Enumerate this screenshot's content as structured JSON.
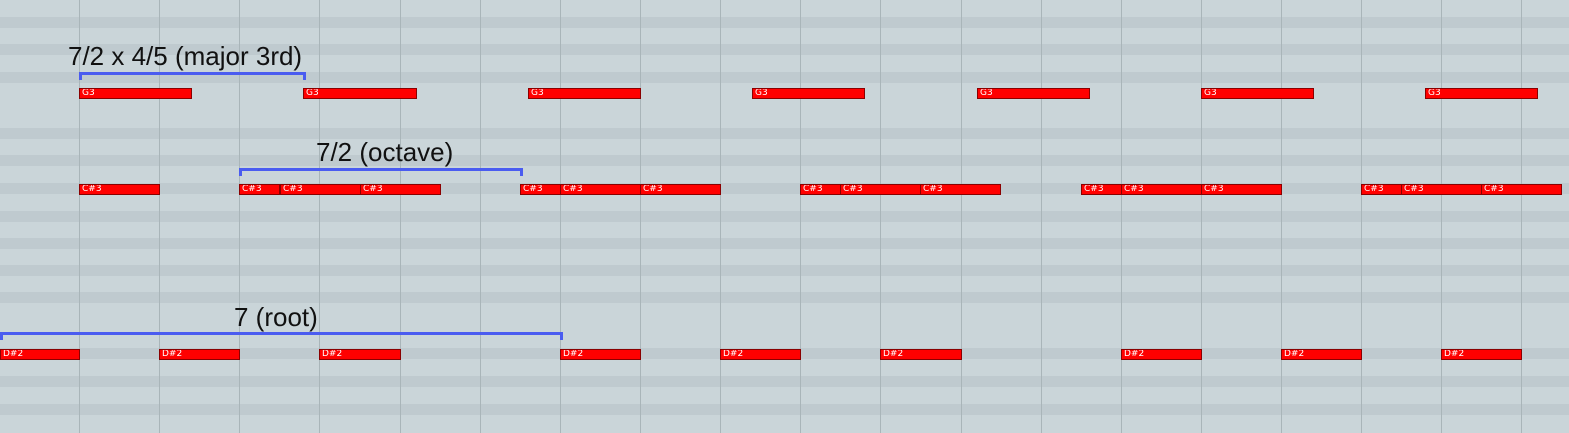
{
  "colors": {
    "background": "#cad5d9",
    "lane": "#bfcacf",
    "note": "#ff0000",
    "bracket": "#4a5cf0"
  },
  "annotations": {
    "major_third": "7/2 x 4/5 (major 3rd)",
    "octave": "7/2 (octave)",
    "root": "7 (root)"
  },
  "rows": [
    {
      "id": "g3",
      "label": "G3",
      "notes": [
        "G3",
        "G3",
        "G3",
        "G3",
        "G3",
        "G3",
        "G3"
      ]
    },
    {
      "id": "cs3",
      "label": "C#3",
      "notes": [
        "C#3",
        "C#3",
        "C#3",
        "C#3",
        "C#3",
        "C#3",
        "C#3",
        "C#3",
        "C#3",
        "C#3",
        "C#3",
        "C#3",
        "C#3",
        "C#3",
        "C#3",
        "C#3"
      ]
    },
    {
      "id": "ds2",
      "label": "D#2",
      "notes": [
        "D#2",
        "D#2",
        "D#2",
        "D#2",
        "D#2",
        "D#2",
        "D#2",
        "D#2",
        "D#2"
      ]
    }
  ]
}
